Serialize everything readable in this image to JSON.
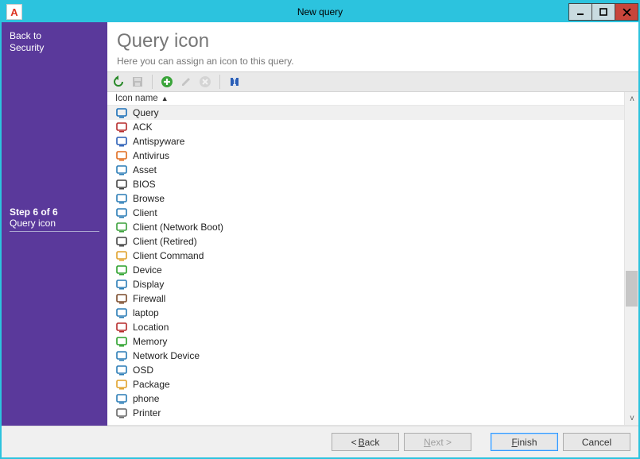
{
  "window_title": "New query",
  "app_letter": "A",
  "sidebar": {
    "back_line1": "Back to",
    "back_line2": "Security",
    "step_line1": "Step 6 of 6",
    "step_line2": "Query icon"
  },
  "main": {
    "heading": "Query icon",
    "subheading": "Here you can assign an icon to this query.",
    "column_header": "Icon name"
  },
  "toolbar": {
    "refresh": "refresh",
    "save": "save",
    "add": "add",
    "edit": "edit",
    "delete": "delete",
    "rename": "rename"
  },
  "items": [
    {
      "label": "Query",
      "selected": true,
      "color": "#1a6fb8"
    },
    {
      "label": "ACK",
      "selected": false,
      "color": "#b62a2a"
    },
    {
      "label": "Antispyware",
      "selected": false,
      "color": "#2a5eb6"
    },
    {
      "label": "Antivirus",
      "selected": false,
      "color": "#e06a1c"
    },
    {
      "label": "Asset",
      "selected": false,
      "color": "#2a7cb6"
    },
    {
      "label": "BIOS",
      "selected": false,
      "color": "#444"
    },
    {
      "label": "Browse",
      "selected": false,
      "color": "#2a7cb6"
    },
    {
      "label": "Client",
      "selected": false,
      "color": "#2a7cb6"
    },
    {
      "label": "Client (Network Boot)",
      "selected": false,
      "color": "#3aa03a"
    },
    {
      "label": "Client (Retired)",
      "selected": false,
      "color": "#444"
    },
    {
      "label": "Client Command",
      "selected": false,
      "color": "#e0a12a"
    },
    {
      "label": "Device",
      "selected": false,
      "color": "#2aa02a"
    },
    {
      "label": "Display",
      "selected": false,
      "color": "#2a7cb6"
    },
    {
      "label": "Firewall",
      "selected": false,
      "color": "#7a4a2a"
    },
    {
      "label": "laptop",
      "selected": false,
      "color": "#2a7cb6"
    },
    {
      "label": "Location",
      "selected": false,
      "color": "#b62a2a"
    },
    {
      "label": "Memory",
      "selected": false,
      "color": "#2aa02a"
    },
    {
      "label": "Network Device",
      "selected": false,
      "color": "#2a7cb6"
    },
    {
      "label": "OSD",
      "selected": false,
      "color": "#2a7cb6"
    },
    {
      "label": "Package",
      "selected": false,
      "color": "#e0a12a"
    },
    {
      "label": "phone",
      "selected": false,
      "color": "#2a7cb6"
    },
    {
      "label": "Printer",
      "selected": false,
      "color": "#666"
    }
  ],
  "buttons": {
    "back": "< Back",
    "next": "Next >",
    "finish": "Finish",
    "cancel": "Cancel"
  }
}
